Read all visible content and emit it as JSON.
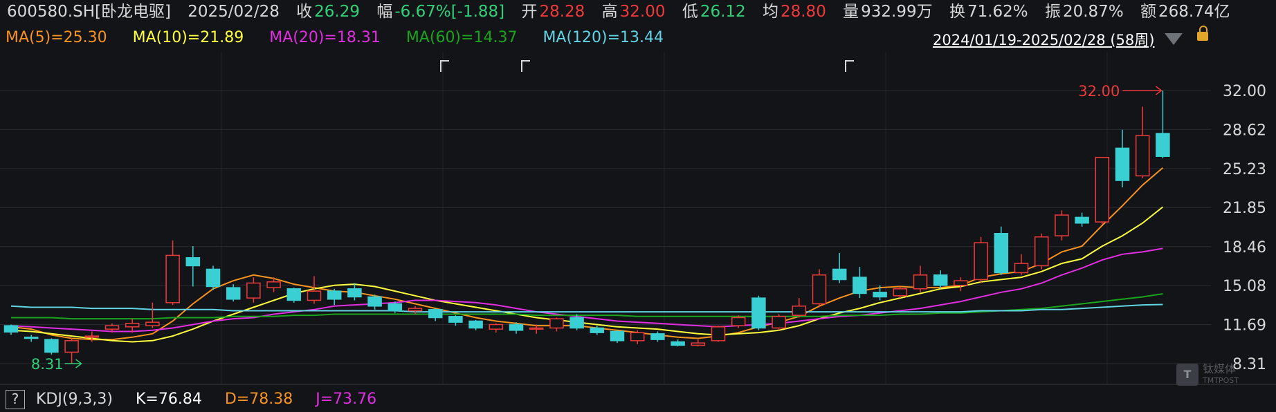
{
  "header": {
    "code": "600580.SH[卧龙电驱]",
    "date": "2025/02/28",
    "close_label": "收",
    "close": "26.29",
    "chg_label": "幅",
    "chg": "-6.67%[-1.88]",
    "open_label": "开",
    "open": "28.28",
    "high_label": "高",
    "high": "32.00",
    "low_label": "低",
    "low": "26.12",
    "avg_label": "均",
    "avg": "28.80",
    "vol_label": "量",
    "vol": "932.99万",
    "turn_label": "换",
    "turn": "71.62%",
    "amp_label": "振",
    "amp": "20.87%",
    "amt_label": "额",
    "amt": "268.74亿"
  },
  "ma": {
    "ma5": "MA(5)=25.30",
    "ma10": "MA(10)=21.89",
    "ma20": "MA(20)=18.31",
    "ma60": "MA(60)=14.37",
    "ma120": "MA(120)=13.44"
  },
  "range_label": "2024/01/19-2025/02/28 (58周)",
  "kdj": {
    "help": "?",
    "name": "KDJ(9,3,3)",
    "k": "K=76.84",
    "d": "D=78.38",
    "j": "J=73.76"
  },
  "watermark": {
    "cn": "钛媒体",
    "en": "TMTPOST"
  },
  "colors": {
    "up": "#ee3a3a",
    "down": "#3ad0d3",
    "ma5": "#f7931e",
    "ma10": "#ffff3c",
    "ma20": "#e22ee2",
    "ma60": "#19a51c",
    "ma120": "#5fd5e6"
  },
  "chart_data": {
    "type": "candlestick",
    "period": "weekly",
    "y_ticks": [
      32.0,
      28.62,
      25.23,
      21.85,
      18.46,
      15.08,
      11.69,
      8.31
    ],
    "ylim": [
      8.31,
      32.0
    ],
    "max_label": "32.00",
    "min_label": "8.31",
    "grid": true,
    "candles": [
      {
        "o": 11.6,
        "c": 11.05,
        "h": 11.7,
        "l": 10.8
      },
      {
        "o": 10.6,
        "c": 10.5,
        "h": 10.8,
        "l": 10.2
      },
      {
        "o": 10.4,
        "c": 9.3,
        "h": 10.5,
        "l": 9.1
      },
      {
        "o": 9.3,
        "c": 10.3,
        "h": 10.5,
        "l": 8.31
      },
      {
        "o": 10.6,
        "c": 10.7,
        "h": 11.1,
        "l": 10.2
      },
      {
        "o": 11.3,
        "c": 11.6,
        "h": 11.8,
        "l": 11.0
      },
      {
        "o": 11.5,
        "c": 11.8,
        "h": 12.2,
        "l": 11.0
      },
      {
        "o": 11.6,
        "c": 11.9,
        "h": 13.6,
        "l": 11.4
      },
      {
        "o": 13.6,
        "c": 17.7,
        "h": 19.0,
        "l": 13.4
      },
      {
        "o": 17.5,
        "c": 16.8,
        "h": 18.5,
        "l": 15.0
      },
      {
        "o": 16.5,
        "c": 15.0,
        "h": 16.8,
        "l": 14.7
      },
      {
        "o": 14.9,
        "c": 13.9,
        "h": 15.2,
        "l": 13.7
      },
      {
        "o": 14.0,
        "c": 15.3,
        "h": 15.8,
        "l": 13.6
      },
      {
        "o": 14.9,
        "c": 15.4,
        "h": 15.8,
        "l": 14.5
      },
      {
        "o": 14.8,
        "c": 13.8,
        "h": 14.9,
        "l": 13.6
      },
      {
        "o": 13.8,
        "c": 14.6,
        "h": 15.9,
        "l": 13.5
      },
      {
        "o": 14.6,
        "c": 13.9,
        "h": 14.8,
        "l": 13.4
      },
      {
        "o": 14.8,
        "c": 14.1,
        "h": 15.3,
        "l": 13.8
      },
      {
        "o": 14.1,
        "c": 13.3,
        "h": 14.3,
        "l": 13.0
      },
      {
        "o": 13.5,
        "c": 12.9,
        "h": 13.7,
        "l": 12.7
      },
      {
        "o": 12.9,
        "c": 13.1,
        "h": 13.3,
        "l": 12.6
      },
      {
        "o": 13.0,
        "c": 12.3,
        "h": 13.1,
        "l": 12.0
      },
      {
        "o": 12.4,
        "c": 11.9,
        "h": 12.5,
        "l": 11.6
      },
      {
        "o": 12.0,
        "c": 11.4,
        "h": 12.1,
        "l": 11.2
      },
      {
        "o": 11.3,
        "c": 11.7,
        "h": 11.8,
        "l": 11.0
      },
      {
        "o": 11.7,
        "c": 11.2,
        "h": 11.9,
        "l": 10.9
      },
      {
        "o": 11.3,
        "c": 11.4,
        "h": 11.7,
        "l": 10.9
      },
      {
        "o": 11.4,
        "c": 12.2,
        "h": 12.3,
        "l": 11.1
      },
      {
        "o": 12.3,
        "c": 11.4,
        "h": 12.6,
        "l": 11.2
      },
      {
        "o": 11.4,
        "c": 11.0,
        "h": 11.6,
        "l": 10.8
      },
      {
        "o": 11.1,
        "c": 10.3,
        "h": 11.2,
        "l": 10.1
      },
      {
        "o": 10.3,
        "c": 11.0,
        "h": 11.2,
        "l": 10.0
      },
      {
        "o": 10.9,
        "c": 10.4,
        "h": 11.1,
        "l": 10.2
      },
      {
        "o": 10.2,
        "c": 9.9,
        "h": 10.4,
        "l": 9.8
      },
      {
        "o": 9.9,
        "c": 10.1,
        "h": 10.4,
        "l": 9.8
      },
      {
        "o": 10.3,
        "c": 11.5,
        "h": 11.6,
        "l": 10.2
      },
      {
        "o": 11.6,
        "c": 12.3,
        "h": 12.5,
        "l": 11.4
      },
      {
        "o": 14.0,
        "c": 11.4,
        "h": 14.2,
        "l": 11.2
      },
      {
        "o": 11.4,
        "c": 12.4,
        "h": 12.6,
        "l": 11.2
      },
      {
        "o": 12.5,
        "c": 13.3,
        "h": 14.0,
        "l": 12.3
      },
      {
        "o": 13.5,
        "c": 16.0,
        "h": 16.5,
        "l": 13.2
      },
      {
        "o": 16.5,
        "c": 15.6,
        "h": 17.9,
        "l": 15.3
      },
      {
        "o": 15.8,
        "c": 14.4,
        "h": 16.7,
        "l": 14.0
      },
      {
        "o": 14.5,
        "c": 14.1,
        "h": 15.1,
        "l": 13.8
      },
      {
        "o": 14.2,
        "c": 14.8,
        "h": 15.0,
        "l": 14.0
      },
      {
        "o": 14.8,
        "c": 16.0,
        "h": 16.8,
        "l": 14.5
      },
      {
        "o": 16.0,
        "c": 15.1,
        "h": 16.4,
        "l": 14.8
      },
      {
        "o": 15.1,
        "c": 15.5,
        "h": 15.8,
        "l": 14.6
      },
      {
        "o": 15.6,
        "c": 18.8,
        "h": 19.3,
        "l": 15.3
      },
      {
        "o": 19.6,
        "c": 16.2,
        "h": 20.2,
        "l": 16.0
      },
      {
        "o": 16.2,
        "c": 17.0,
        "h": 17.8,
        "l": 16.0
      },
      {
        "o": 16.8,
        "c": 19.3,
        "h": 19.6,
        "l": 16.5
      },
      {
        "o": 19.4,
        "c": 21.2,
        "h": 21.6,
        "l": 19.0
      },
      {
        "o": 21.0,
        "c": 20.5,
        "h": 21.4,
        "l": 20.2
      },
      {
        "o": 20.6,
        "c": 26.2,
        "h": 26.2,
        "l": 20.4
      },
      {
        "o": 27.0,
        "c": 24.2,
        "h": 28.6,
        "l": 23.6
      },
      {
        "o": 24.6,
        "c": 28.1,
        "h": 30.6,
        "l": 24.4
      },
      {
        "o": 28.28,
        "c": 26.29,
        "h": 32.0,
        "l": 26.12
      }
    ],
    "ma_series": [
      {
        "name": "MA5",
        "values": [
          11.5,
          11.3,
          10.8,
          10.5,
          10.4,
          10.4,
          10.6,
          10.9,
          12.0,
          13.5,
          14.8,
          15.5,
          16.0,
          15.7,
          15.2,
          14.9,
          14.6,
          14.5,
          14.2,
          13.9,
          13.5,
          13.1,
          12.7,
          12.3,
          12.0,
          11.8,
          11.6,
          11.6,
          11.6,
          11.4,
          11.2,
          11.0,
          10.8,
          10.6,
          10.5,
          10.7,
          11.0,
          11.5,
          11.9,
          12.4,
          13.3,
          14.0,
          14.6,
          14.9,
          15.0,
          14.9,
          14.9,
          15.1,
          15.8,
          16.1,
          16.3,
          17.0,
          18.0,
          18.5,
          20.3,
          22.0,
          23.8,
          25.3
        ]
      },
      {
        "name": "MA10",
        "values": [
          11.2,
          11.1,
          10.9,
          10.7,
          10.5,
          10.3,
          10.2,
          10.3,
          10.7,
          11.3,
          12.0,
          12.6,
          13.2,
          13.8,
          14.4,
          14.8,
          15.1,
          15.2,
          15.0,
          14.6,
          14.2,
          13.8,
          13.5,
          13.2,
          12.9,
          12.6,
          12.3,
          12.1,
          11.9,
          11.7,
          11.5,
          11.4,
          11.3,
          11.1,
          10.9,
          10.8,
          10.9,
          11.0,
          11.2,
          11.6,
          12.2,
          12.7,
          13.1,
          13.6,
          14.0,
          14.4,
          14.8,
          15.0,
          15.4,
          15.6,
          15.8,
          16.3,
          17.0,
          17.4,
          18.5,
          19.4,
          20.5,
          21.9
        ]
      },
      {
        "name": "MA20",
        "values": [
          11.6,
          11.5,
          11.4,
          11.3,
          11.2,
          11.1,
          11.1,
          11.2,
          11.4,
          11.7,
          12.0,
          12.2,
          12.3,
          12.6,
          12.8,
          13.0,
          13.3,
          13.4,
          13.5,
          13.6,
          13.8,
          13.8,
          13.7,
          13.6,
          13.4,
          13.1,
          12.8,
          12.6,
          12.4,
          12.2,
          12.0,
          11.9,
          11.8,
          11.7,
          11.6,
          11.5,
          11.6,
          11.7,
          11.8,
          12.0,
          12.2,
          12.4,
          12.5,
          12.7,
          12.9,
          13.1,
          13.4,
          13.7,
          14.1,
          14.5,
          14.8,
          15.3,
          16.0,
          16.6,
          17.3,
          17.8,
          18.0,
          18.3
        ]
      },
      {
        "name": "MA60",
        "values": [
          12.3,
          12.3,
          12.3,
          12.2,
          12.2,
          12.2,
          12.2,
          12.2,
          12.3,
          12.3,
          12.3,
          12.4,
          12.4,
          12.4,
          12.5,
          12.5,
          12.6,
          12.6,
          12.6,
          12.6,
          12.6,
          12.6,
          12.6,
          12.6,
          12.6,
          12.6,
          12.5,
          12.5,
          12.5,
          12.5,
          12.5,
          12.4,
          12.4,
          12.4,
          12.4,
          12.4,
          12.4,
          12.4,
          12.4,
          12.4,
          12.4,
          12.5,
          12.5,
          12.5,
          12.6,
          12.6,
          12.7,
          12.7,
          12.8,
          12.9,
          13.0,
          13.1,
          13.3,
          13.5,
          13.7,
          13.9,
          14.1,
          14.37
        ]
      },
      {
        "name": "MA120",
        "values": [
          13.3,
          13.2,
          13.2,
          13.2,
          13.1,
          13.1,
          13.1,
          13.0,
          13.0,
          13.0,
          13.0,
          12.9,
          12.9,
          12.9,
          12.9,
          12.9,
          12.9,
          12.9,
          12.9,
          12.9,
          12.8,
          12.8,
          12.8,
          12.8,
          12.8,
          12.8,
          12.8,
          12.8,
          12.8,
          12.8,
          12.8,
          12.8,
          12.8,
          12.8,
          12.8,
          12.8,
          12.8,
          12.8,
          12.8,
          12.8,
          12.8,
          12.8,
          12.8,
          12.8,
          12.8,
          12.8,
          12.8,
          12.8,
          12.9,
          12.9,
          12.9,
          13.0,
          13.0,
          13.1,
          13.2,
          13.3,
          13.4,
          13.44
        ]
      }
    ]
  }
}
